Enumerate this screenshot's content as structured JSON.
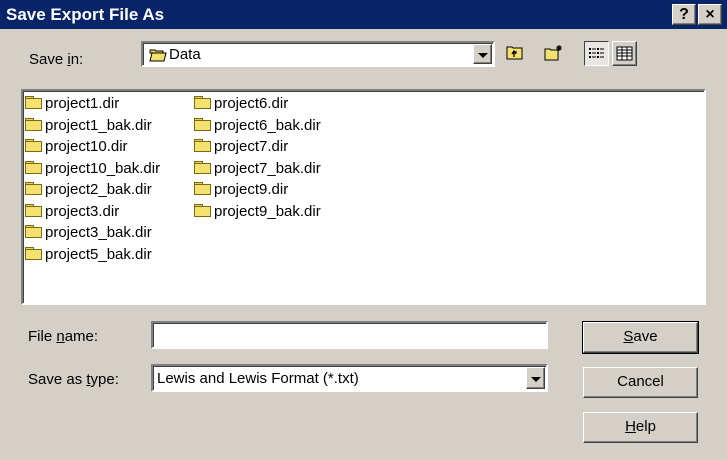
{
  "window": {
    "title": "Save Export File As",
    "help_glyph": "?",
    "close_glyph": "×"
  },
  "save_in": {
    "label_pre": "Save ",
    "label_key": "i",
    "label_post": "n:",
    "folder_icon": "open-folder-icon",
    "value": "Data"
  },
  "toolbar": [
    {
      "name": "up-one-level-icon"
    },
    {
      "name": "create-new-folder-icon"
    },
    {
      "name": "list-view-icon",
      "active": true
    },
    {
      "name": "details-view-icon"
    }
  ],
  "files": {
    "column1": [
      "project1.dir",
      "project1_bak.dir",
      "project10.dir",
      "project10_bak.dir",
      "project2_bak.dir",
      "project3.dir",
      "project3_bak.dir",
      "project5_bak.dir"
    ],
    "column2": [
      "project6.dir",
      "project6_bak.dir",
      "project7.dir",
      "project7_bak.dir",
      "project9.dir",
      "project9_bak.dir"
    ]
  },
  "file_name": {
    "label_pre": "File ",
    "label_key": "n",
    "label_post": "ame:",
    "value": ""
  },
  "save_as_type": {
    "label_pre": "Save as ",
    "label_key": "t",
    "label_post": "ype:",
    "value": "Lewis and Lewis Format (*.txt)"
  },
  "buttons": {
    "save_key": "S",
    "save_rest": "ave",
    "cancel": "Cancel",
    "help_key": "H",
    "help_rest": "elp"
  }
}
